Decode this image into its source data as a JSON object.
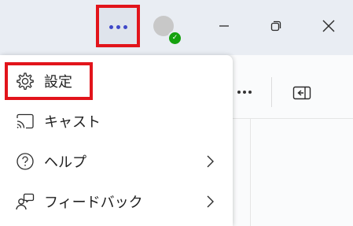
{
  "titlebar": {
    "more_button": {
      "glyph": "•••",
      "icon": "more-horizontal-icon"
    },
    "profile": {
      "status": "online",
      "status_color": "#14a10e"
    },
    "minimize_icon": "minimize-icon",
    "restore_icon": "restore-icon",
    "close_icon": "close-icon"
  },
  "menu": {
    "items": [
      {
        "label": "設定",
        "icon": "gear-icon",
        "has_submenu": false,
        "highlighted": true
      },
      {
        "label": "キャスト",
        "icon": "cast-icon",
        "has_submenu": false
      },
      {
        "label": "ヘルプ",
        "icon": "help-icon",
        "has_submenu": true
      },
      {
        "label": "フィードバック",
        "icon": "feedback-icon",
        "has_submenu": true
      }
    ]
  },
  "toolbar": {
    "more_icon": "more-horizontal-icon",
    "sidebar_toggle_icon": "sidebar-toggle-icon"
  },
  "colors": {
    "accent": "#3f48c8",
    "highlight_box": "#e2141b",
    "titlebar_bg": "#e9edf3"
  }
}
